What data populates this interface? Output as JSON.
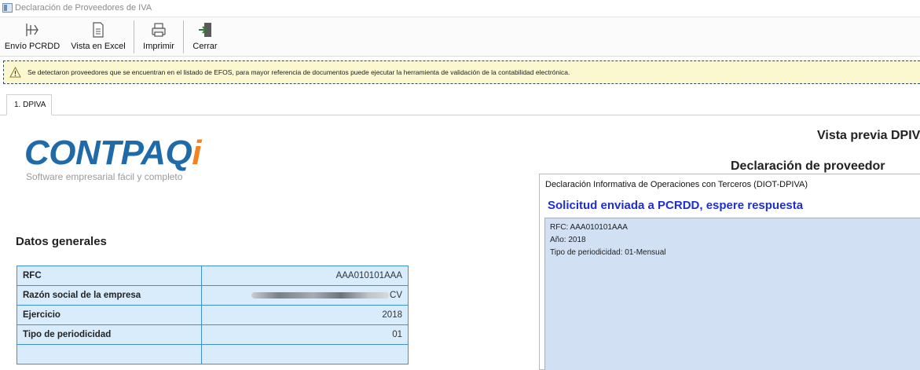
{
  "window": {
    "title": "Declaración de Proveedores de IVA",
    "icon": "app-window-icon"
  },
  "toolbar": {
    "buttons": [
      {
        "label": "Envío PCRDD",
        "icon": "send-icon"
      },
      {
        "label": "Vista en Excel",
        "icon": "document-icon"
      },
      {
        "label": "Imprimir",
        "icon": "printer-icon"
      },
      {
        "label": "Cerrar",
        "icon": "exit-icon"
      }
    ]
  },
  "alert": {
    "icon": "warning-icon",
    "message": "Se detectaron proveedores que se encuentran en el listado de EFOS, para mayor referencia de documentos puede ejecutar la herramienta de validación de la contabilidad electrónica.",
    "background": "#fbf7cf"
  },
  "tabs": [
    {
      "label": "1. DPIVA",
      "active": true
    }
  ],
  "document": {
    "logo": {
      "word_main": "CONTPAQ",
      "word_accent": "i",
      "tagline": "Software empresarial fácil y completo",
      "brand_blue": "#1f6aa8",
      "brand_orange": "#f58220"
    },
    "preview_title": "Vista previa DPIVA",
    "preview_subtitle": "Declaración de proveedor",
    "section_title": "Datos generales",
    "table": [
      {
        "label": "RFC",
        "value": "AAA010101AAA"
      },
      {
        "label": "Razón social de la empresa",
        "value": "CV",
        "redacted": true
      },
      {
        "label": "Ejercicio",
        "value": "2018"
      },
      {
        "label": "Tipo de periodicidad",
        "value": "01"
      },
      {
        "label": "",
        "value": ""
      }
    ]
  },
  "dialog": {
    "title": "Declaración Informativa de Operaciones con Terceros (DIOT-DPIVA)",
    "heading": "Solicitud enviada a PCRDD, espere respuesta",
    "heading_color": "#1d2fd1",
    "lines": [
      "RFC: AAA010101AAA",
      "Año: 2018",
      "Tipo de periodicidad: 01-Mensual"
    ]
  }
}
